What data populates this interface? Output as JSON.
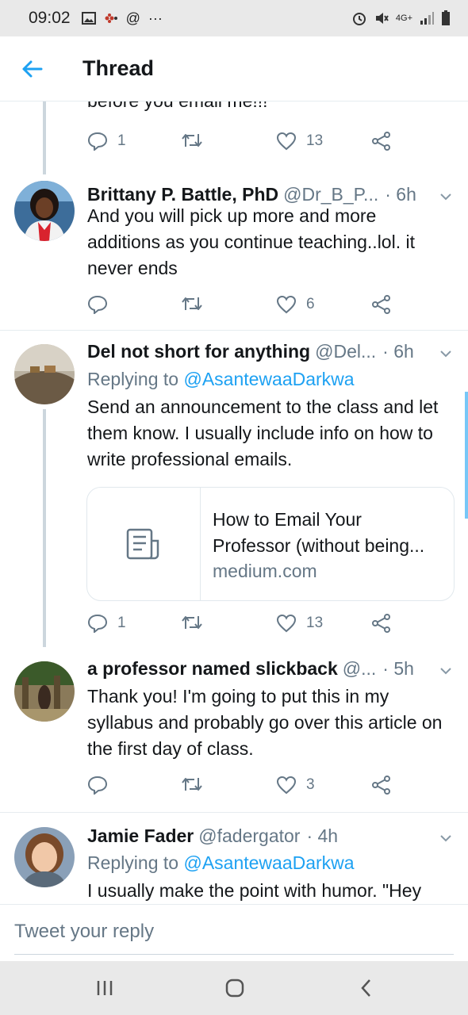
{
  "status": {
    "time": "09:02",
    "network": "4G+"
  },
  "header": {
    "title": "Thread"
  },
  "partial": {
    "text": "before you email me!!!",
    "replies": "1",
    "likes": "13"
  },
  "tweets": [
    {
      "name": "Brittany P. Battle, PhD",
      "handle": "@Dr_B_P...",
      "time": "· 6h",
      "replying": "",
      "body": "And you will pick up more and more additions as you continue teaching..lol. it never ends",
      "replies": "",
      "likes": "6"
    },
    {
      "name": "Del not short for anything",
      "handle": "@Del...",
      "time": "· 6h",
      "replying_prefix": "Replying to ",
      "replying": "@AsantewaaDarkwa",
      "body": "Send an announcement to the class and let them know. I usually include info on how to write professional emails.",
      "card": {
        "title": "How to Email Your Professor (without being...",
        "domain": "medium.com"
      },
      "replies": "1",
      "likes": "13"
    },
    {
      "name": "a professor named slickback",
      "handle": "@...",
      "time": "· 5h",
      "replying": "",
      "body": "Thank you! I'm going to put this in my syllabus and probably go over this article on the first day of class.",
      "replies": "",
      "likes": "3"
    },
    {
      "name": "Jamie Fader",
      "handle": "@fadergator",
      "time": "· 4h",
      "replying_prefix": "Replying to ",
      "replying": "@AsantewaaDarkwa",
      "body": "I usually make the point with humor. \"Hey"
    }
  ],
  "reply_bar": {
    "placeholder": "Tweet your reply"
  },
  "colors": {
    "accent": "#1da1f2",
    "secondary_text": "#657786",
    "thread_line": "#ccd6dd"
  }
}
